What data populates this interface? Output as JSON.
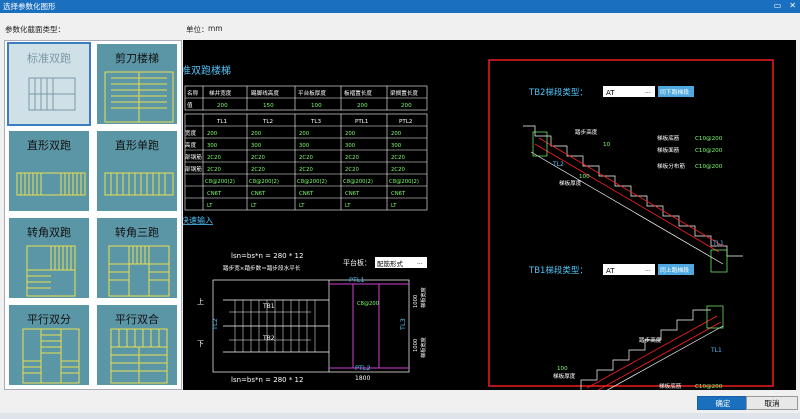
{
  "window": {
    "title": "选择参数化图形",
    "min": "▭",
    "close": "✕"
  },
  "labels": {
    "section_type": "参数化截面类型：",
    "unit_label": "单位：",
    "unit_value": "mm"
  },
  "tiles": [
    {
      "label": "标准双跑"
    },
    {
      "label": "剪刀楼梯"
    },
    {
      "label": "直形双跑"
    },
    {
      "label": "直形单跑"
    },
    {
      "label": "转角双跑"
    },
    {
      "label": "转角三跑"
    },
    {
      "label": "平行双分"
    },
    {
      "label": "平行双合"
    }
  ],
  "cad": {
    "heading": "准双跑楼梯",
    "table1": {
      "headers": [
        "名称",
        "梯井宽度",
        "踢脚线高度",
        "平台板厚度",
        "板褶置长度",
        "梁搁置长度"
      ],
      "row": [
        "值",
        "200",
        "150",
        "100",
        "200",
        "200"
      ]
    },
    "table2": {
      "headers": [
        "",
        "TL1",
        "TL2",
        "TL3",
        "PTL1",
        "PTL2"
      ],
      "rows": [
        [
          "宽度",
          "200",
          "200",
          "200",
          "200",
          "200"
        ],
        [
          "高度",
          "300",
          "300",
          "300",
          "300",
          "300"
        ],
        [
          "部钢筋",
          "2C20",
          "2C20",
          "2C20",
          "2C20",
          "2C20"
        ],
        [
          "部钢筋",
          "2C20",
          "2C20",
          "2C20",
          "2C20",
          "2C20"
        ],
        [
          "",
          "C8@200(2)",
          "C8@200(2)",
          "C8@200(2)",
          "C8@200(2)",
          "C8@200(2)"
        ],
        [
          "",
          "CN6T",
          "CN6T",
          "CN6T",
          "CN6T",
          "CN6T"
        ],
        [
          "",
          "LT",
          "LT",
          "LT",
          "LT",
          "LT"
        ]
      ]
    },
    "quick_input": "快速输入",
    "formula_top": "lsn=bs*n = 280 * 12",
    "formula_note": "踏步宽×踏步数＝踏步段水平长",
    "formula_bottom": "lsn=bs*n = 280 * 12",
    "platform_label": "平台板：",
    "platform_value": "配筋形式",
    "tb2_label": "TB2梯段类型：",
    "tb2_value": "AT",
    "tb2_link": "同下跑梯段",
    "tb1_label": "TB1梯段类型：",
    "tb1_value": "AT",
    "tb1_link": "同上跑梯段",
    "tb2_notes": {
      "step_h": "踏步高度",
      "bottom_bar": "梯板底筋",
      "bottom_val": "C10@200",
      "top_bar": "梯板面筋",
      "top_val": "C10@200",
      "dist_bar": "梯板分布筋",
      "dist_val": "C10@200",
      "thick_val": "100",
      "thick": "梯板厚度",
      "tl2": "TL2",
      "tl1": "TL1",
      "ten": "10"
    },
    "tb1_notes": {
      "step_h": "踏步高度",
      "thick_val": "100",
      "thick": "梯板厚度",
      "bottom_bar": "梯板底筋",
      "bottom_val": "C10@200",
      "tl1": "TL1"
    },
    "plan": {
      "tb1": "TB1",
      "tb2": "TB2",
      "up": "上",
      "down": "下",
      "ptl1": "PTL1",
      "ptl2": "PTL2",
      "tl2": "TL2",
      "tl3": "TL3",
      "c8": "C8@200",
      "d1000a": "1000",
      "d1000b": "1000",
      "d1800": "1800",
      "sw1": "梯板宽度",
      "sw2": "梯板宽度"
    }
  },
  "buttons": {
    "ok": "确定",
    "cancel": "取消"
  }
}
